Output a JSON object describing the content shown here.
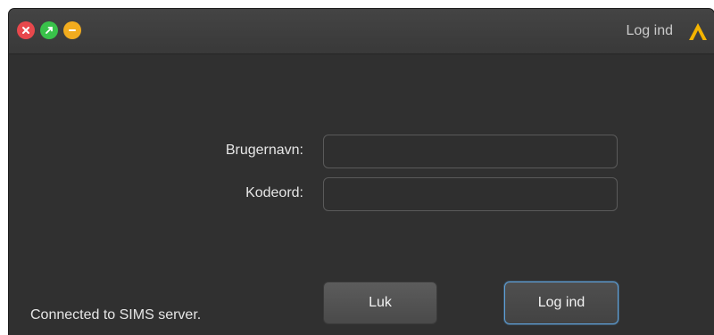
{
  "window": {
    "title": "Log ind",
    "logo_icon": "app-logo-icon",
    "logo_color": "#f4b400",
    "controls": {
      "close_color": "#e8484c",
      "maximize_color": "#39c24a",
      "minimize_color": "#f2ac1e"
    }
  },
  "form": {
    "username_label": "Brugernavn:",
    "username_value": "",
    "password_label": "Kodeord:",
    "password_value": ""
  },
  "buttons": {
    "close_label": "Luk",
    "login_label": "Log ind",
    "focus_color": "#5ea0d8"
  },
  "status": {
    "text": "Connected to SIMS server."
  }
}
